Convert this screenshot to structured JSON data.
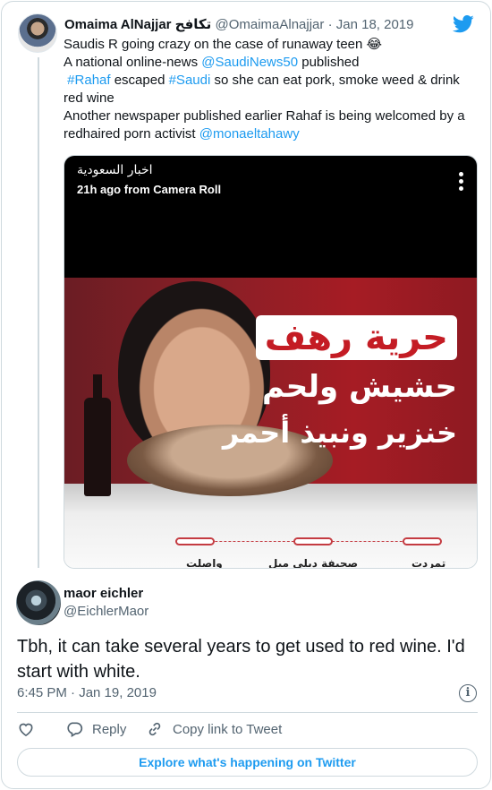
{
  "quoted_tweet": {
    "author_name": "Omaima AlNajjar تكافح",
    "author_handle": "@OmaimaAlnajjar",
    "separator": "·",
    "date": "Jan 18, 2019",
    "text_lines": [
      [
        "Saudis R going crazy on the case of runaway teen 😂"
      ],
      [
        "A national online-news ",
        "@SaudiNews50",
        " published"
      ],
      [
        "#Rahaf",
        " escaped ",
        "#Saudi",
        " so she can eat pork, smoke weed & drink"
      ],
      [
        "red wine"
      ],
      [
        "Another newspaper published earlier Rahaf is being welcomed by a"
      ],
      [
        "redhaired porn activist ",
        "@monaeltahawy"
      ]
    ],
    "media": {
      "story_title": "اخبار السعودية",
      "story_subtitle": "21h ago from Camera Roll",
      "headline_1": "حرية رهف",
      "headline_2": "حشيش ولحم",
      "headline_3": "خنزير ونبيذ أحمر",
      "bottom_tags": [
        "واصلت",
        "صحيفة ديلي ميل",
        "تمردت"
      ]
    }
  },
  "main_tweet": {
    "author_name": "maor eichler",
    "author_handle": "@EichlerMaor",
    "text_line_1": "Tbh, it can take several years to get used to red wine. I'd",
    "text_line_2": "start with white.",
    "timestamp": "6:45 PM · Jan 19, 2019"
  },
  "actions": {
    "like_icon": "heart-icon",
    "reply_label": "Reply",
    "copy_link_label": "Copy link to Tweet"
  },
  "explore_label": "Explore what's happening on Twitter",
  "colors": {
    "link": "#1d9bf0",
    "text": "#0f1419",
    "muted": "#536471",
    "border": "#cfd9de"
  }
}
